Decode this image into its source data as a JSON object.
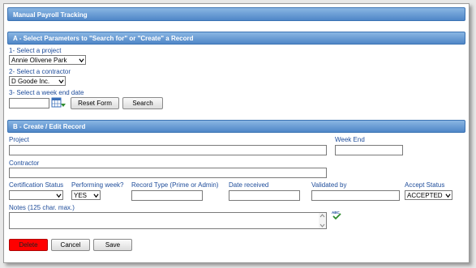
{
  "header": {
    "title": "Manual Payroll Tracking"
  },
  "section_a": {
    "title": "A - Select Parameters to \"Search for\" or \"Create\" a Record",
    "project_label": "1- Select a project",
    "project_value": "Annie Olivene Park",
    "contractor_label": "2- Select a contractor",
    "contractor_value": "D Goode Inc.",
    "week_label": "3- Select a week end date",
    "week_value": "",
    "reset_label": "Reset Form",
    "search_label": "Search"
  },
  "section_b": {
    "title": "B - Create / Edit Record",
    "project_label": "Project",
    "week_end_label": "Week End",
    "contractor_label": "Contractor",
    "cert_status_label": "Certification Status",
    "cert_status_value": "",
    "performing_week_label": "Performing week?",
    "performing_week_value": "YES",
    "record_type_label": "Record Type (Prime or Admin)",
    "date_received_label": "Date received",
    "validated_by_label": "Validated by",
    "accept_status_label": "Accept Status",
    "accept_status_value": "ACCEPTED",
    "notes_label": "Notes (125 char. max.)",
    "delete_label": "Delete",
    "cancel_label": "Cancel",
    "save_label": "Save"
  },
  "colors": {
    "header_bar": "#4f86c7",
    "label_text": "#1e4c9a",
    "delete_button": "#ff0000"
  },
  "icons": {
    "calendar": "calendar-icon",
    "spellcheck": "spellcheck-icon",
    "dropdown": "chevron-down-icon"
  }
}
